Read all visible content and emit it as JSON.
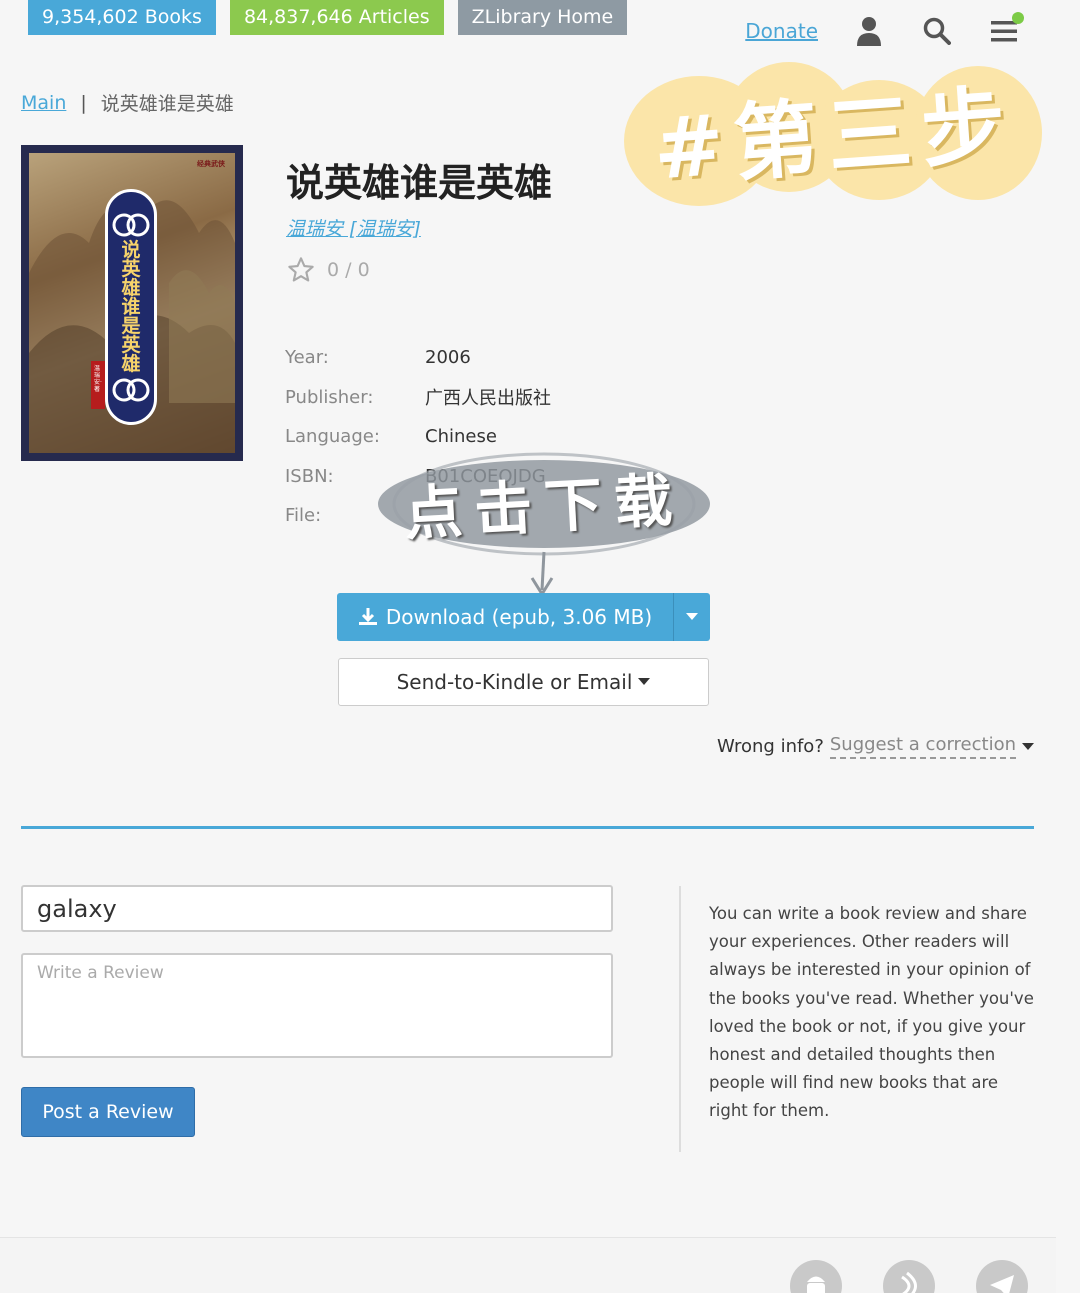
{
  "tabs": [
    {
      "label": "9,354,602 Books",
      "color": "#49a8d8"
    },
    {
      "label": "84,837,646 Articles",
      "color": "#8cc94e"
    },
    {
      "label": "ZLibrary Home",
      "color": "#8e9aa3"
    }
  ],
  "nav": {
    "donate": "Donate",
    "icons": [
      "user-icon",
      "search-icon",
      "menu-icon"
    ]
  },
  "breadcrumb": {
    "main": "Main",
    "separator": "|",
    "current": "说英雄谁是英雄"
  },
  "stamp": {
    "text": "#第三步"
  },
  "cover": {
    "band_text": "说英雄谁是英雄",
    "top_label": "经典武侠",
    "side_label": "温瑞安·著"
  },
  "book": {
    "title": "说英雄谁是英雄",
    "author": "温瑞安 [温瑞安]",
    "rating": "0 / 0"
  },
  "details": [
    {
      "key": "Year:",
      "value": "2006"
    },
    {
      "key": "Publisher:",
      "value": "广西人民出版社"
    },
    {
      "key": "Language:",
      "value": "Chinese"
    },
    {
      "key": "ISBN:",
      "value": "B01COEOJDG"
    },
    {
      "key": "File:",
      "value": ""
    }
  ],
  "annotation": {
    "text": "点击下载"
  },
  "download": {
    "label": "Download (epub, 3.06 MB)",
    "kindle": "Send-to-Kindle or Email"
  },
  "correction": {
    "question": "Wrong info?",
    "link": "Suggest a correction"
  },
  "review": {
    "name_value": "galaxy",
    "placeholder": "Write a Review",
    "post_label": "Post a Review",
    "info": "You can write a book review and share your experiences. Other readers will always be interested in your opinion of the books you've read. Whether you've loved the book or not, if you give your honest and detailed thoughts then people will find new books that are right for them."
  },
  "footer": {
    "icons": [
      "android-icon",
      "audio-icon",
      "telegram-icon"
    ]
  },
  "colors": {
    "accent": "#49a8d8",
    "green": "#8cc94e",
    "post_button": "#3f86c6"
  }
}
